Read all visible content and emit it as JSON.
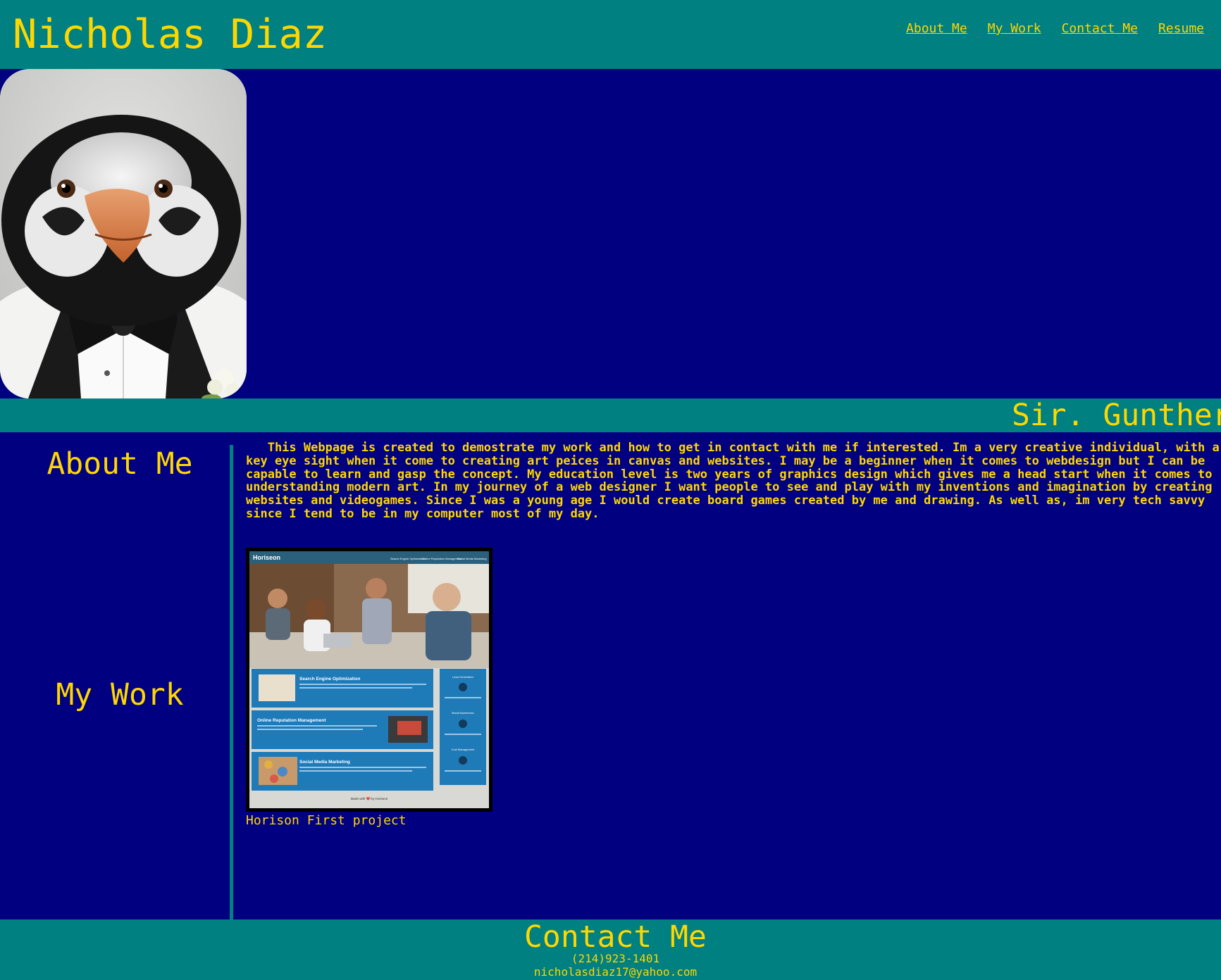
{
  "header": {
    "title": "Nicholas Diaz",
    "nav": [
      {
        "label": "About Me"
      },
      {
        "label": "My Work"
      },
      {
        "label": "Contact Me"
      },
      {
        "label": "Resume"
      }
    ]
  },
  "hero": {
    "image_icon": "penguin-in-tuxedo-portrait"
  },
  "banner": {
    "text": "Sir. Gunther"
  },
  "about": {
    "heading": "About Me",
    "paragraph_lines": [
      "   This Webpage is created to demostrate my work and how to get in contact with me if interested. Im a very creative individual, with a",
      "key eye sight when it come to creating art peices in canvas and websites. I may be a beginner when it comes to webdesign but I can be",
      "capable to learn and gasp the concept. My education level is two years of graphics design which gives me a head start when it comes to",
      "understanding modern art. In my journey of a web designer I want people to see and play with my inventions and imagination by creating",
      "websites and videogames. Since I was a young age I would create board games created by me and drawing. As well as, im very tech savvy",
      "since I tend to be in my computer most of my day."
    ]
  },
  "work": {
    "heading": "My Work",
    "projects": [
      {
        "caption": "Horison First project",
        "thumbnail": {
          "brand": "Horiseon",
          "nav": [
            "Search Engine Optimization",
            "Online Reputation Management",
            "Social Media Marketing"
          ],
          "sections": [
            "Search Engine Optimization",
            "Online Reputation Management",
            "Social Media Marketing"
          ],
          "sidebar": [
            "Lead Generation",
            "Brand Awareness",
            "Cost Management"
          ],
          "footer": "Made with ❤️ by Horiseon"
        }
      }
    ]
  },
  "contact": {
    "heading": "Contact Me",
    "phone": "(214)923-1401",
    "email": "nicholasdiaz17@yahoo.com"
  },
  "colors": {
    "teal": "#008080",
    "navy": "#000080",
    "gold": "#FFD700"
  }
}
